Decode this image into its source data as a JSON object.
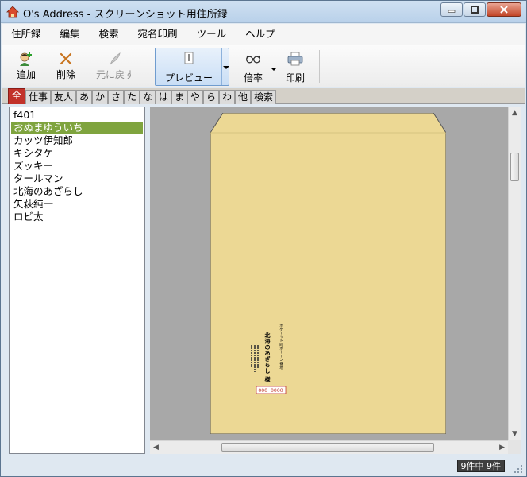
{
  "window": {
    "title": "O's Address - スクリーンショット用住所録"
  },
  "menu": [
    "住所録",
    "編集",
    "検索",
    "宛名印刷",
    "ツール",
    "ヘルプ"
  ],
  "toolbar": {
    "add": "追加",
    "delete": "削除",
    "undo": "元に戻す",
    "preview": "プレビュー",
    "zoom": "倍率",
    "print": "印刷"
  },
  "tabs": [
    "全",
    "仕事",
    "友人",
    "あ",
    "か",
    "さ",
    "た",
    "な",
    "は",
    "ま",
    "や",
    "ら",
    "わ",
    "他",
    "検索"
  ],
  "contacts": [
    "f401",
    "おぬまゆういち",
    "カッツ伊知郎",
    "キシタケ",
    "ズッキー",
    "タールマン",
    "北海のあざらし",
    "矢萩純一",
    "ロビ太"
  ],
  "selected_contact_index": 1,
  "envelope": {
    "address_line": "ポケーット町ホーーン番地",
    "recipient": "北海のあざらし 様",
    "postal_code": "000 0000"
  },
  "status": {
    "count": "9件中 9件"
  },
  "colors": {
    "selected_tab": "#c2322a",
    "selected_item": "#7fa43e",
    "envelope": "#ecd894"
  }
}
